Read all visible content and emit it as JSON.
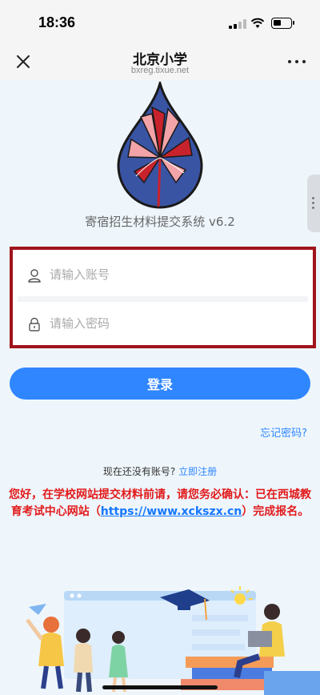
{
  "status_bar": {
    "time": "18:36"
  },
  "nav": {
    "title": "北京小学",
    "subtitle": "bxreg.tixue.net"
  },
  "app": {
    "title": "寄宿招生材料提交系统 v6.2"
  },
  "form": {
    "username_placeholder": "请输入账号",
    "password_placeholder": "请输入密码",
    "login_label": "登录"
  },
  "links": {
    "forgot_password": "忘记密码?",
    "no_account_text": "现在还没有账号?",
    "register_label": "立即注册"
  },
  "notice": {
    "text_before": "您好，在学校网站提交材料前请，请您务必确认：已在西城教育考试中心网站（",
    "link_text": "https://www.xckszx.cn",
    "text_after": "）完成报名。"
  },
  "colors": {
    "accent": "#2f86ff",
    "notice_red": "#e21a1a",
    "highlight_border": "#a0141c",
    "logo_blue": "#3a54a4",
    "logo_red": "#c8232c",
    "logo_pink": "#f2a4a8"
  }
}
